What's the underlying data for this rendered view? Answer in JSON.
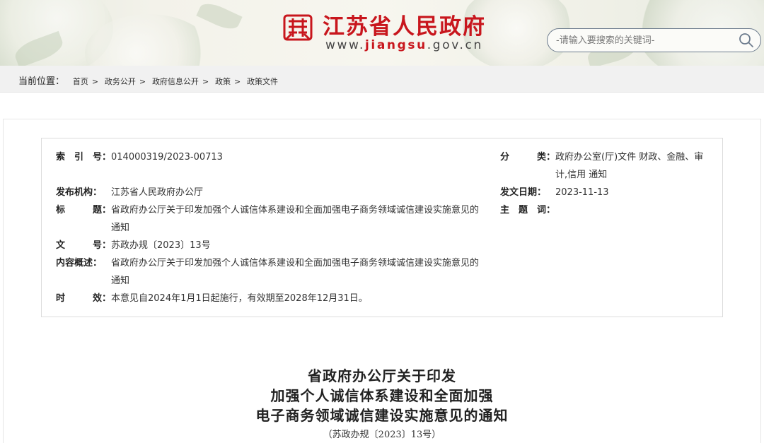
{
  "header": {
    "site_title": "江苏省人民政府",
    "url_prefix": "www.",
    "url_domain": "jiangsu",
    "url_suffix": ".gov.cn",
    "search": {
      "placeholder": "-请输入要搜索的关键词-"
    },
    "colors": {
      "brand": "#c8161d"
    }
  },
  "breadcrumb": {
    "label": "当前位置：",
    "items": [
      "首页",
      "政务公开",
      "政府信息公开",
      "政策",
      "政策文件"
    ],
    "separator": ">"
  },
  "meta": {
    "index_label": "索　引　号：",
    "index_value": "014000319/2023-00713",
    "category_label": "分　　　类：",
    "category_value": "政府办公室(厅)文件 财政、金融、审计,信用 通知",
    "publisher_label": "发布机构：",
    "publisher_value": "江苏省人民政府办公厅",
    "date_label": "发文日期：",
    "date_value": "2023-11-13",
    "title_label": "标　　　题：",
    "title_value": "省政府办公厅关于印发加强个人诚信体系建设和全面加强电子商务领域诚信建设实施意见的通知",
    "subject_label": "主　题　词：",
    "subject_value": "",
    "docno_label": "文　　　号：",
    "docno_value": "苏政办规〔2023〕13号",
    "summary_label": "内容概述：",
    "summary_value": "省政府办公厅关于印发加强个人诚信体系建设和全面加强电子商务领域诚信建设实施意见的通知",
    "validity_label": "时　　　效：",
    "validity_value": "本意见自2024年1月1日起施行，有效期至2028年12月31日。"
  },
  "article": {
    "title_lines": [
      "省政府办公厅关于印发",
      "加强个人诚信体系建设和全面加强",
      "电子商务领域诚信建设实施意见的通知"
    ],
    "doc_number": "（苏政办规〔2023〕13号）"
  }
}
